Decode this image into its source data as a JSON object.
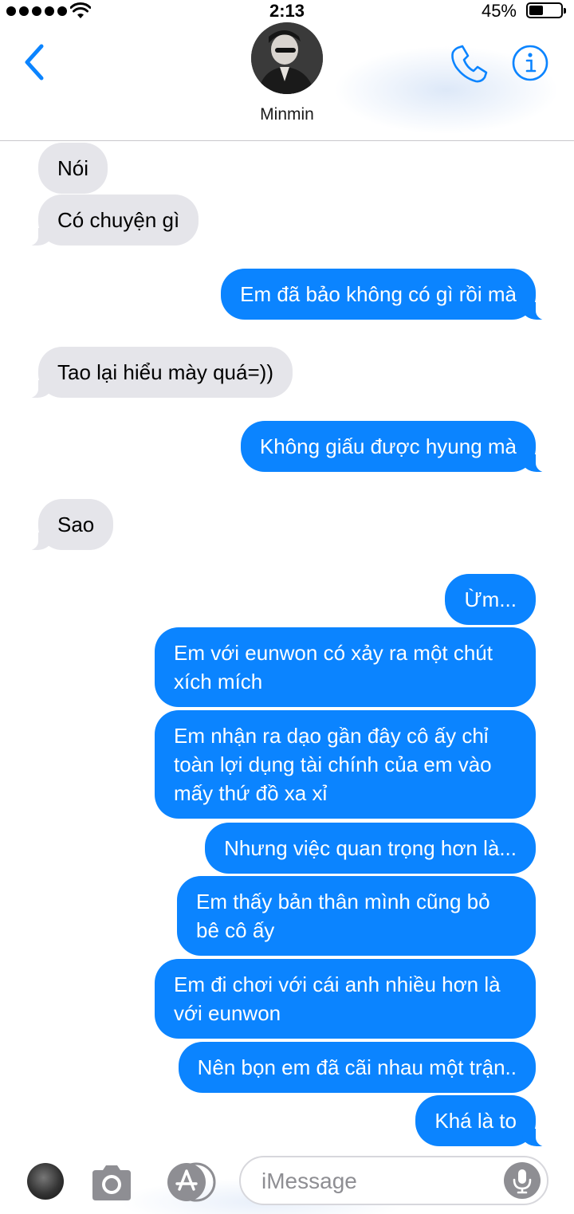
{
  "status_bar": {
    "time": "2:13",
    "battery_percent": "45%",
    "battery_level": 0.45,
    "signal_bars": 5
  },
  "header": {
    "contact_name": "Minmin"
  },
  "messages": [
    {
      "side": "in",
      "text": "Nói"
    },
    {
      "side": "in",
      "text": "Có chuyện gì"
    },
    {
      "side": "out",
      "text": "Em đã bảo không có gì rồi mà"
    },
    {
      "side": "in",
      "text": "Tao lại hiểu mày quá=))"
    },
    {
      "side": "out",
      "text": "Không giấu được hyung mà"
    },
    {
      "side": "in",
      "text": "Sao"
    },
    {
      "side": "out",
      "text": "Ừm..."
    },
    {
      "side": "out",
      "text": "Em với eunwon có xảy ra một chút xích mích"
    },
    {
      "side": "out",
      "text": "Em nhận ra dạo gần đây cô ấy chỉ toàn lợi dụng tài chính của em vào mấy thứ đồ xa xỉ"
    },
    {
      "side": "out",
      "text": "Nhưng việc quan trọng hơn là..."
    },
    {
      "side": "out",
      "text": "Em thấy bản thân mình cũng bỏ bê cô ấy"
    },
    {
      "side": "out",
      "text": "Em đi chơi với cái anh nhiều hơn là với eunwon"
    },
    {
      "side": "out",
      "text": "Nên bọn em đã cãi nhau một trận.."
    },
    {
      "side": "out",
      "text": "Khá là to"
    }
  ],
  "input": {
    "placeholder": "iMessage"
  },
  "colors": {
    "accent": "#0b84ff",
    "incoming_bubble": "#e5e5ea",
    "outgoing_bubble": "#0b84ff"
  }
}
